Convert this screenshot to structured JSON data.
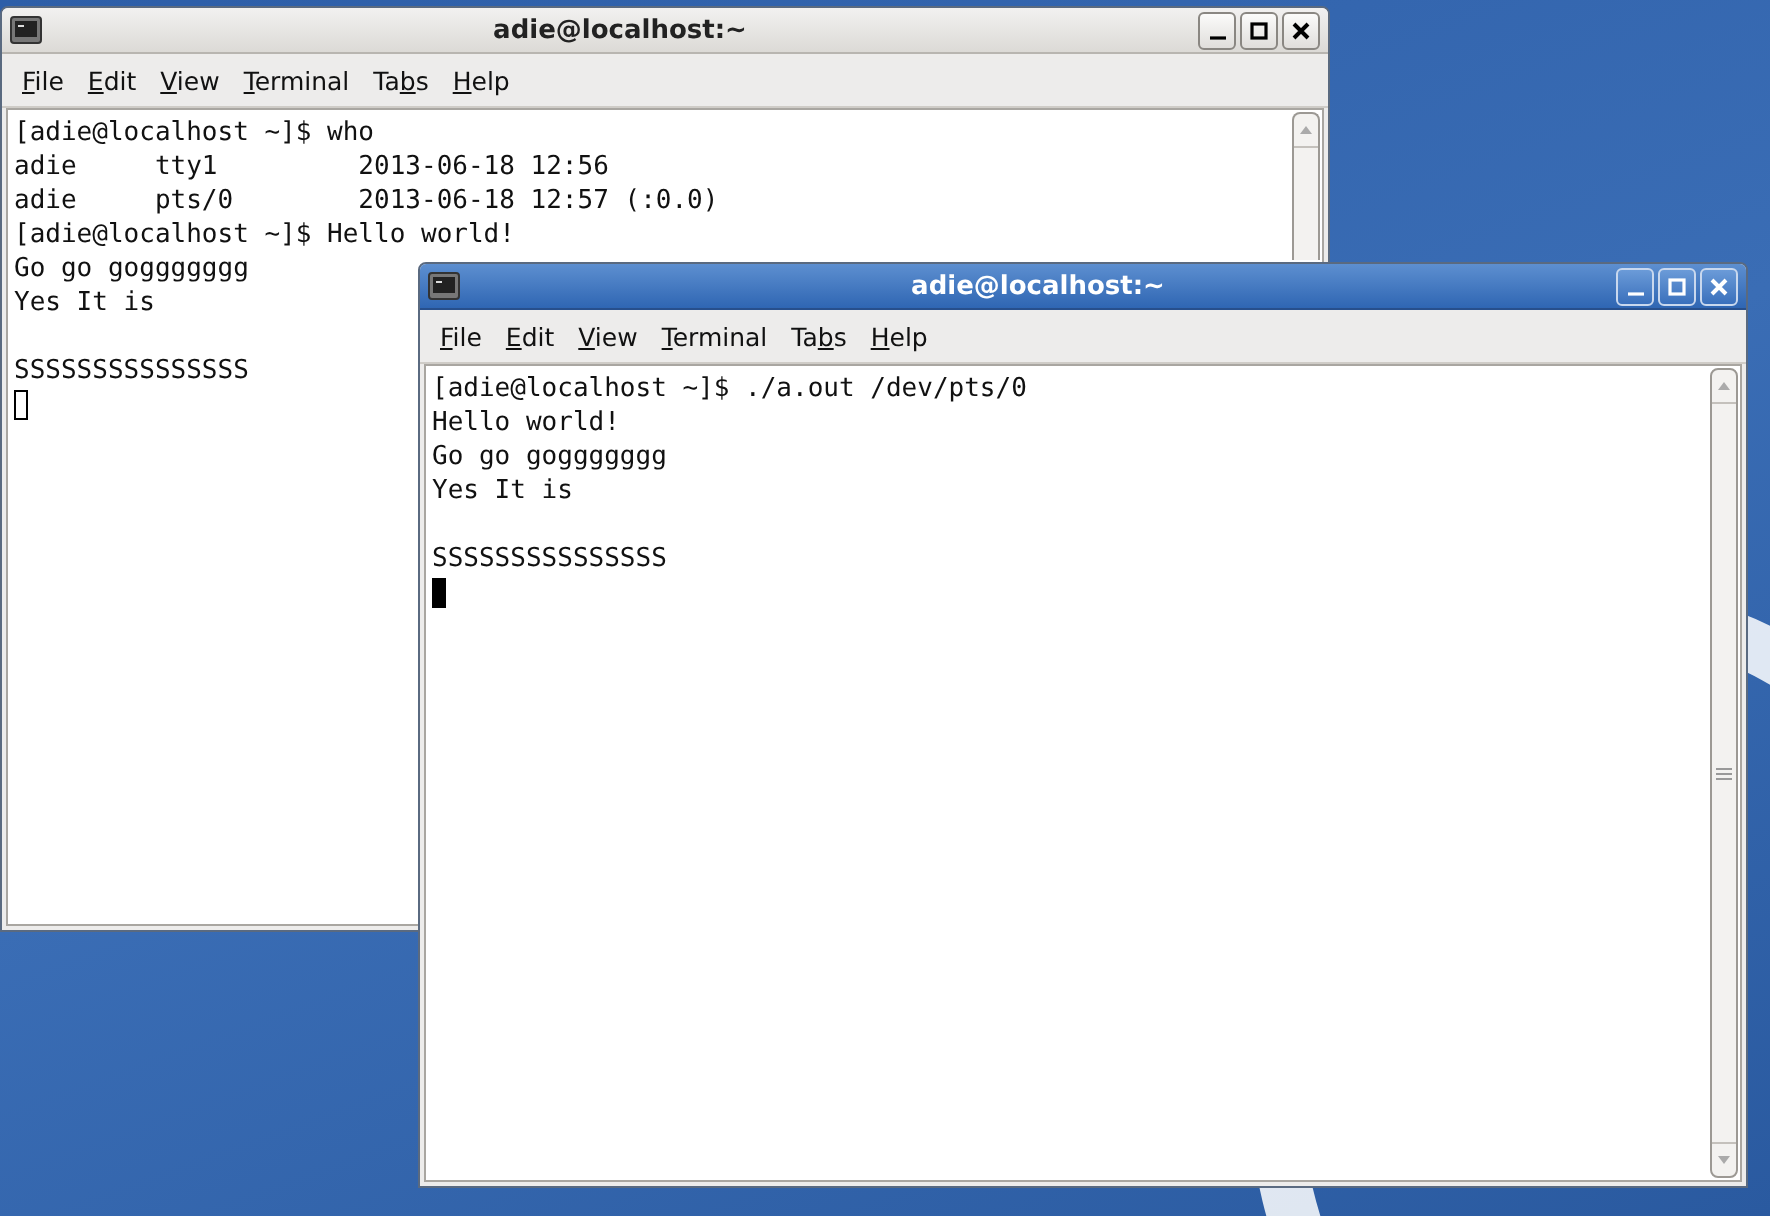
{
  "windows": [
    {
      "title": "adie@localhost:~",
      "focused": false,
      "menu": [
        {
          "key": "F",
          "after": "ile"
        },
        {
          "key": "E",
          "after": "dit"
        },
        {
          "key": "V",
          "after": "iew"
        },
        {
          "key": "T",
          "after": "erminal"
        },
        {
          "before": "Ta",
          "key": "b",
          "after": "s"
        },
        {
          "key": "H",
          "after": "elp"
        }
      ],
      "lines": [
        {
          "kind": "text",
          "text": "[adie@localhost ~]$ who"
        },
        {
          "kind": "text",
          "text": "adie     tty1         2013-06-18 12:56"
        },
        {
          "kind": "text",
          "text": "adie     pts/0        2013-06-18 12:57 (:0.0)"
        },
        {
          "kind": "text",
          "text": "[adie@localhost ~]$ Hello world!"
        },
        {
          "kind": "text",
          "text": "Go go goggggggg"
        },
        {
          "kind": "text",
          "text": "Yes It is"
        },
        {
          "kind": "blank"
        },
        {
          "kind": "text",
          "text": "SSSSSSSSSSSSSSS"
        }
      ]
    },
    {
      "title": "adie@localhost:~",
      "focused": true,
      "menu": [
        {
          "key": "F",
          "after": "ile"
        },
        {
          "key": "E",
          "after": "dit"
        },
        {
          "key": "V",
          "after": "iew"
        },
        {
          "key": "T",
          "after": "erminal"
        },
        {
          "before": "Ta",
          "key": "b",
          "after": "s"
        },
        {
          "key": "H",
          "after": "elp"
        }
      ],
      "lines": [
        {
          "kind": "text",
          "text": "[adie@localhost ~]$ ./a.out /dev/pts/0"
        },
        {
          "kind": "text",
          "text": "Hello world!"
        },
        {
          "kind": "text",
          "text": "Go go goggggggg"
        },
        {
          "kind": "text",
          "text": "Yes It is"
        },
        {
          "kind": "blank"
        },
        {
          "kind": "text",
          "text": "SSSSSSSSSSSSSSS"
        }
      ]
    }
  ]
}
